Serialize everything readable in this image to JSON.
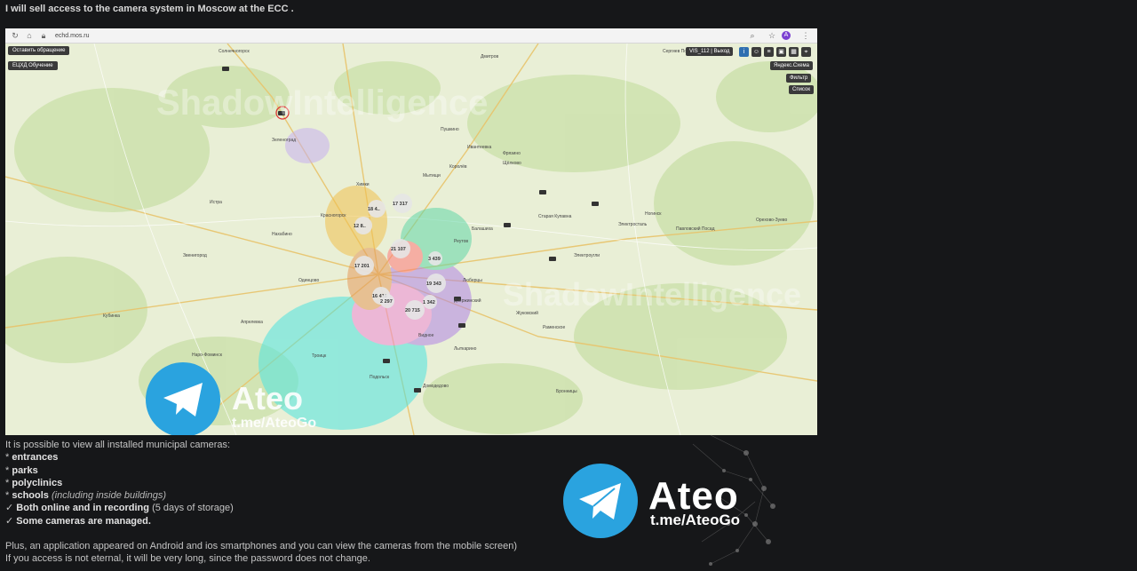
{
  "post": {
    "title": "I will sell access to the camera system in Moscow at the ECC .",
    "intro": "It is possible to view all installed municipal cameras:",
    "bullet_prefix": "*",
    "items": [
      {
        "label": "entrances",
        "note": ""
      },
      {
        "label": "parks",
        "note": ""
      },
      {
        "label": "polyclinics",
        "note": ""
      },
      {
        "label": "schools",
        "note": "(including inside buildings)"
      }
    ],
    "checks": [
      {
        "mark": "✓",
        "text": "Both online and in recording",
        "suffix": " (5 days of storage)"
      },
      {
        "mark": "✓",
        "text": "Some cameras are managed.",
        "suffix": ""
      }
    ],
    "footer1": "Plus, an application appeared on Android and ios smartphones and you can view the cameras from the mobile screen)",
    "footer2": "If you access is not eternal, it will be very long, since the password does not change."
  },
  "screenshot": {
    "url": "echd.mos.ru",
    "avatar_letter": "A",
    "btn_appeal": "Оставить обращение",
    "btn_training": "ЕЦХД Обучение",
    "user_tag": "VIS_112",
    "user_exit": "Выход",
    "btn_scheme": "Яндекс.Схема",
    "btn_filter": "Фильтр",
    "btn_list": "Список",
    "watermark": "ShadowIntelligence",
    "map_places": [
      "Солнечногорск",
      "Дмитров",
      "Сергиев Посад",
      "Красногорск",
      "Химки",
      "Мытищи",
      "Королёв",
      "Щёлково",
      "Фрязино",
      "Балашиха",
      "Реутов",
      "Одинцово",
      "Люберцы",
      "Подольск",
      "Домодедово",
      "Видное",
      "Раменское",
      "Жуковский",
      "Электросталь",
      "Ногинск",
      "Павловский Посад",
      "Орехово-Зуево",
      "Наро-Фоминск",
      "Троицк",
      "Звенигород",
      "Истра",
      "Нахабино",
      "Дзержинский",
      "Пушкино",
      "Ивантеевка",
      "Лыткарино",
      "Кубинка",
      "Апрелевка",
      "Бронницы",
      "Электроугли",
      "Старая Купавна",
      "Зеленоград"
    ],
    "clusters": [
      "17 317",
      "18 4..",
      "12 8..",
      "21 107",
      "17 201",
      "19 343",
      "20 715",
      "16 416",
      "3 439",
      "2 297",
      "1 342"
    ],
    "telegram_brand": "Ateo",
    "telegram_link": "t.me/AteoGo"
  },
  "logo": {
    "brand": "Ateo",
    "link": "t.me/AteoGo",
    "colors": {
      "telegram_blue": "#2aa3df",
      "text": "#ffffff"
    }
  },
  "colors": {
    "background": "#161719",
    "text": "#c8c8c8"
  }
}
